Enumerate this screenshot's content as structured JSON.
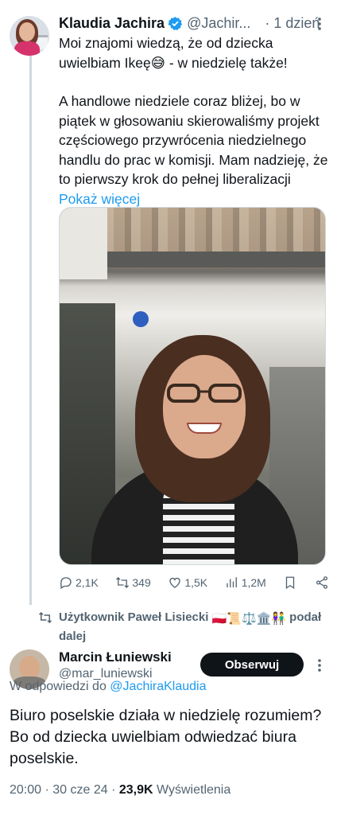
{
  "tweet": {
    "author_name": "Klaudia Jachira",
    "author_handle": "@Jachir...",
    "time_sep": "·",
    "time": "1 dzień",
    "paragraph1": "Moi znajomi wiedzą, że od dziecka uwielbiam Ikeę😅 - w niedzielę także!",
    "paragraph2": "A handlowe niedziele coraz bliżej, bo w piątek w głosowaniu skierowaliśmy projekt częściowego przywrócenia niedzielnego handlu do prac w komisji. Mam nadzieję, że to pierwszy krok do pełnej liberalizacji",
    "show_more": "Pokaż więcej",
    "actions": {
      "replies": "2,1K",
      "reposts": "349",
      "likes": "1,5K",
      "views": "1,2M"
    }
  },
  "retweet_notice": {
    "text": "Użytkownik Paweł Lisiecki",
    "emoji": "🇵🇱📜⚖️🏛️👫",
    "suffix": "podał dalej"
  },
  "reply": {
    "author_name": "Marcin Łuniewski",
    "author_handle": "@mar_luniewski",
    "follow_label": "Obserwuj",
    "reply_prefix": "W odpowiedzi do",
    "reply_mention": "@JachiraKlaudia",
    "text": "Biuro poselskie działa w niedzielę rozumiem? Bo od dziecka uwielbiam odwiedzać biura poselskie.",
    "timestamp": "20:00 · 30 cze 24 ·",
    "views_count": "23,9K",
    "views_label": "Wyświetlenia"
  },
  "colors": {
    "link": "#1d9bf0",
    "secondary_text": "#536471",
    "primary_text": "#0f1419",
    "follow_button_bg": "#0f1419"
  },
  "icons": [
    "verified-badge-icon",
    "more-icon",
    "reply-icon",
    "repost-icon",
    "like-icon",
    "views-icon",
    "bookmark-icon",
    "share-icon",
    "retweet-indicator-icon"
  ]
}
